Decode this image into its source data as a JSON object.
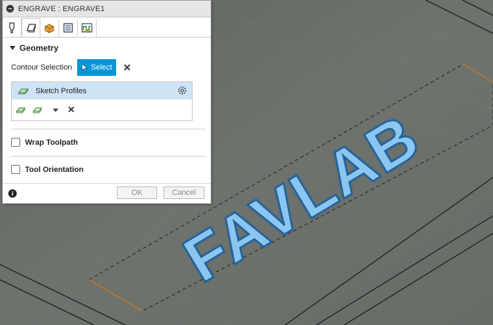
{
  "window": {
    "title": "ENGRAVE : ENGRAVE1"
  },
  "tabs": [
    {
      "icon": "tool-icon"
    },
    {
      "icon": "geometry-icon"
    },
    {
      "icon": "heights-icon"
    },
    {
      "icon": "passes-icon"
    },
    {
      "icon": "linking-icon"
    }
  ],
  "geometry": {
    "heading": "Geometry",
    "contour_label": "Contour Selection",
    "select_label": "Select",
    "list_item_label": "Sketch Profiles"
  },
  "options": {
    "wrap_label": "Wrap Toolpath",
    "orientation_label": "Tool Orientation"
  },
  "footer": {
    "ok_label": "OK",
    "cancel_label": "Cancel",
    "info": "i"
  },
  "viewport": {
    "engraved_text": "FAVLAB"
  },
  "colors": {
    "accent": "#0696d7",
    "selected_row": "#cfe3f7",
    "engraving": "#6fb6ef",
    "boundary": "#c07830"
  }
}
